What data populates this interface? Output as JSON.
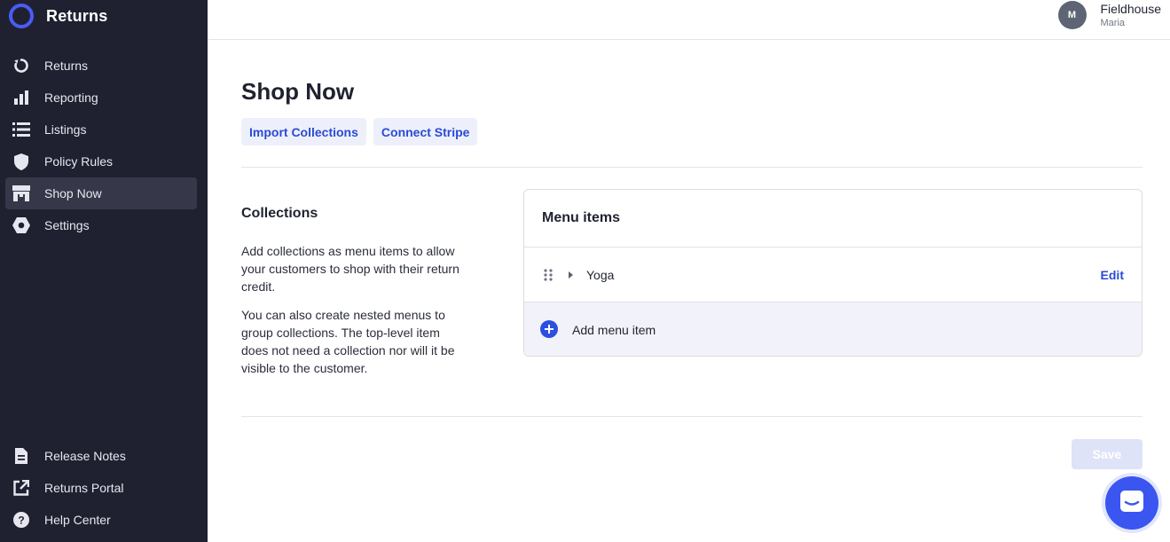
{
  "app": {
    "name": "Returns"
  },
  "sidebar": {
    "items": [
      {
        "label": "Returns",
        "icon": "refresh-icon"
      },
      {
        "label": "Reporting",
        "icon": "bar-chart-icon"
      },
      {
        "label": "Listings",
        "icon": "list-icon"
      },
      {
        "label": "Policy Rules",
        "icon": "shield-icon"
      },
      {
        "label": "Shop Now",
        "icon": "storefront-icon",
        "active": true
      },
      {
        "label": "Settings",
        "icon": "gear-icon"
      }
    ],
    "bottom_items": [
      {
        "label": "Release Notes",
        "icon": "document-icon"
      },
      {
        "label": "Returns Portal",
        "icon": "external-link-icon"
      },
      {
        "label": "Help Center",
        "icon": "help-icon"
      }
    ]
  },
  "user": {
    "initial": "M",
    "org": "Fieldhouse",
    "name": "Maria"
  },
  "page": {
    "title": "Shop Now",
    "actions": {
      "import_label": "Import Collections",
      "connect_label": "Connect Stripe"
    }
  },
  "collections": {
    "title": "Collections",
    "desc1": "Add collections as menu items to allow your customers to shop with their return credit.",
    "desc2": "You can also create nested menus to group collections. The top-level item does not need a collection nor will it be visible to the customer."
  },
  "menu": {
    "title": "Menu items",
    "items": [
      {
        "label": "Yoga",
        "edit_label": "Edit"
      }
    ],
    "add_label": "Add menu item"
  },
  "footer": {
    "save_label": "Save"
  },
  "colors": {
    "sidebar_bg": "#1f2131",
    "accent": "#2b4ad6",
    "active_nav": "#363849"
  }
}
